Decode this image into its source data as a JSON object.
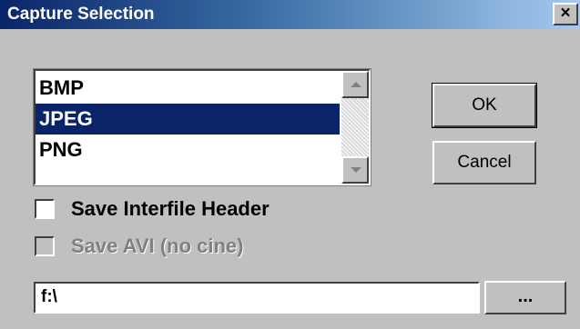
{
  "window": {
    "title": "Capture Selection",
    "close_label": "×"
  },
  "format_list": {
    "items": [
      {
        "label": "BMP",
        "selected": false
      },
      {
        "label": "JPEG",
        "selected": true
      },
      {
        "label": "PNG",
        "selected": false
      }
    ]
  },
  "buttons": {
    "ok_label": "OK",
    "cancel_label": "Cancel",
    "browse_label": "..."
  },
  "options": {
    "save_interfile_header": {
      "label": "Save Interfile Header",
      "checked": false,
      "enabled": true
    },
    "save_avi": {
      "label": "Save AVI (no cine)",
      "checked": false,
      "enabled": false
    }
  },
  "path_field": {
    "value": "f:\\"
  },
  "colors": {
    "title_gradient_start": "#0a246a",
    "title_gradient_end": "#a6caf0",
    "selection": "#0a246a",
    "dialog_face": "#c0c0c0"
  }
}
